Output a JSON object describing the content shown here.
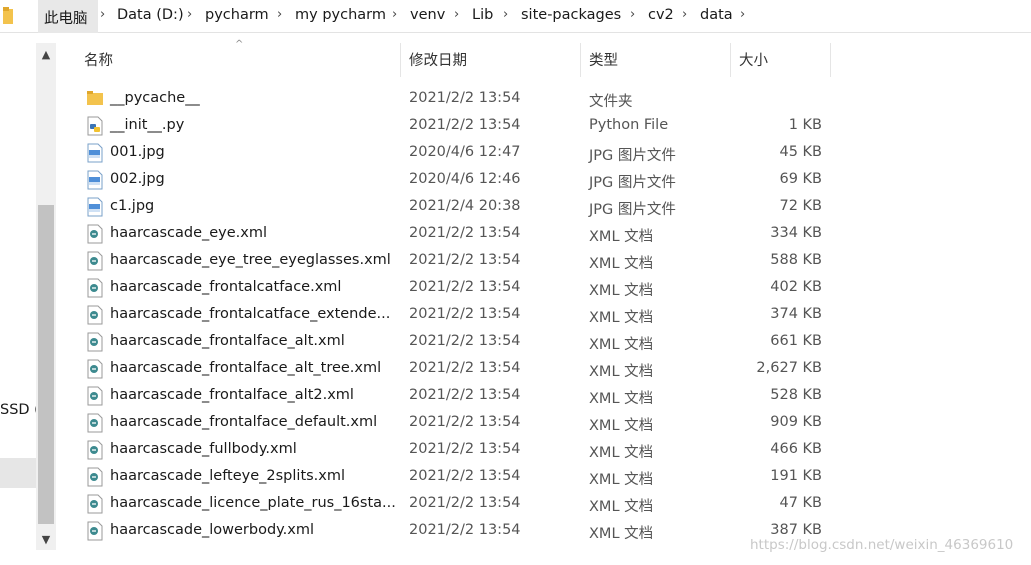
{
  "breadcrumb": {
    "items": [
      "此电脑",
      "Data (D:)",
      "pycharm",
      "my pycharm",
      "venv",
      "Lib",
      "site-packages",
      "cv2",
      "data"
    ],
    "separator": "›"
  },
  "nav": {
    "drive_label": "SSD ("
  },
  "columns": {
    "name": "名称",
    "date": "修改日期",
    "type": "类型",
    "size": "大小"
  },
  "files": [
    {
      "name": "__pycache__",
      "date": "2021/2/2 13:54",
      "type": "文件夹",
      "size": "",
      "icon": "folder-icon"
    },
    {
      "name": "__init__.py",
      "date": "2021/2/2 13:54",
      "type": "Python File",
      "size": "1 KB",
      "icon": "python-file-icon"
    },
    {
      "name": "001.jpg",
      "date": "2020/4/6 12:47",
      "type": "JPG 图片文件",
      "size": "45 KB",
      "icon": "image-file-icon"
    },
    {
      "name": "002.jpg",
      "date": "2020/4/6 12:46",
      "type": "JPG 图片文件",
      "size": "69 KB",
      "icon": "image-file-icon"
    },
    {
      "name": "c1.jpg",
      "date": "2021/2/4 20:38",
      "type": "JPG 图片文件",
      "size": "72 KB",
      "icon": "image-file-icon"
    },
    {
      "name": "haarcascade_eye.xml",
      "date": "2021/2/2 13:54",
      "type": "XML 文档",
      "size": "334 KB",
      "icon": "xml-file-icon"
    },
    {
      "name": "haarcascade_eye_tree_eyeglasses.xml",
      "date": "2021/2/2 13:54",
      "type": "XML 文档",
      "size": "588 KB",
      "icon": "xml-file-icon"
    },
    {
      "name": "haarcascade_frontalcatface.xml",
      "date": "2021/2/2 13:54",
      "type": "XML 文档",
      "size": "402 KB",
      "icon": "xml-file-icon"
    },
    {
      "name": "haarcascade_frontalcatface_extende...",
      "date": "2021/2/2 13:54",
      "type": "XML 文档",
      "size": "374 KB",
      "icon": "xml-file-icon"
    },
    {
      "name": "haarcascade_frontalface_alt.xml",
      "date": "2021/2/2 13:54",
      "type": "XML 文档",
      "size": "661 KB",
      "icon": "xml-file-icon"
    },
    {
      "name": "haarcascade_frontalface_alt_tree.xml",
      "date": "2021/2/2 13:54",
      "type": "XML 文档",
      "size": "2,627 KB",
      "icon": "xml-file-icon"
    },
    {
      "name": "haarcascade_frontalface_alt2.xml",
      "date": "2021/2/2 13:54",
      "type": "XML 文档",
      "size": "528 KB",
      "icon": "xml-file-icon"
    },
    {
      "name": "haarcascade_frontalface_default.xml",
      "date": "2021/2/2 13:54",
      "type": "XML 文档",
      "size": "909 KB",
      "icon": "xml-file-icon"
    },
    {
      "name": "haarcascade_fullbody.xml",
      "date": "2021/2/2 13:54",
      "type": "XML 文档",
      "size": "466 KB",
      "icon": "xml-file-icon"
    },
    {
      "name": "haarcascade_lefteye_2splits.xml",
      "date": "2021/2/2 13:54",
      "type": "XML 文档",
      "size": "191 KB",
      "icon": "xml-file-icon"
    },
    {
      "name": "haarcascade_licence_plate_rus_16sta...",
      "date": "2021/2/2 13:54",
      "type": "XML 文档",
      "size": "47 KB",
      "icon": "xml-file-icon"
    },
    {
      "name": "haarcascade_lowerbody.xml",
      "date": "2021/2/2 13:54",
      "type": "XML 文档",
      "size": "387 KB",
      "icon": "xml-file-icon"
    }
  ],
  "watermark": "https://blog.csdn.net/weixin_46369610"
}
